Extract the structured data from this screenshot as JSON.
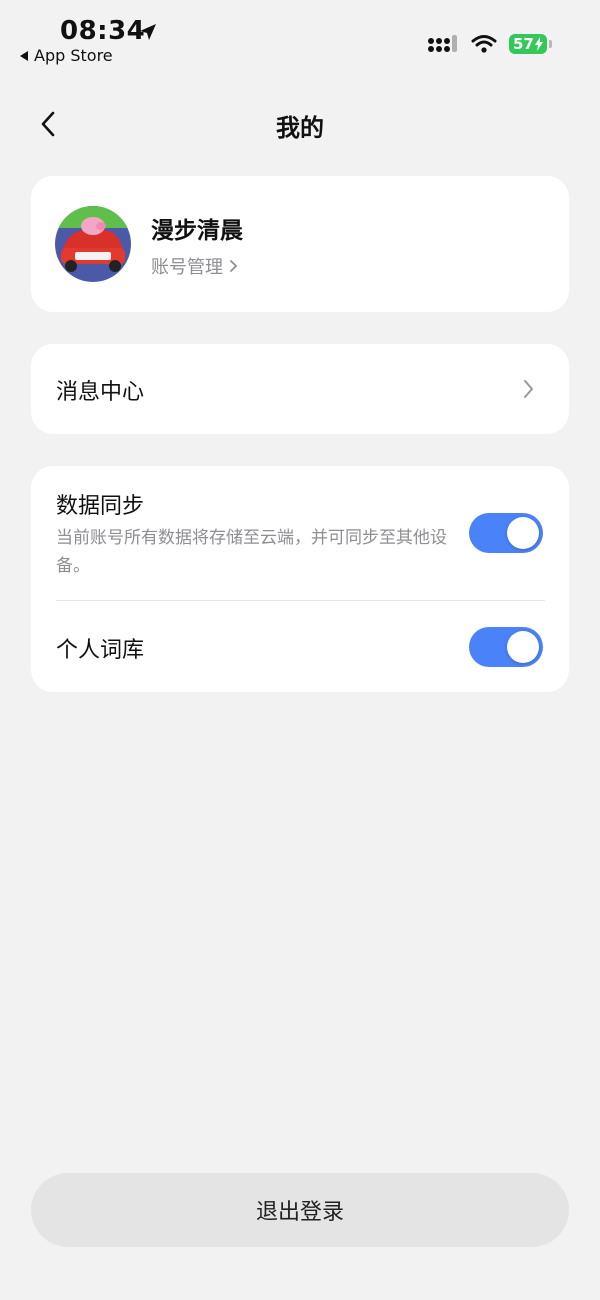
{
  "status_bar": {
    "time": "08:34",
    "back_app": "App Store",
    "battery": "57",
    "icons": [
      "location-arrow-icon",
      "signal-icon",
      "wifi-icon",
      "battery-charging-icon"
    ]
  },
  "nav": {
    "title": "我的",
    "back_icon": "chevron-left-icon"
  },
  "profile": {
    "username": "漫步清晨",
    "account_link": "账号管理"
  },
  "menu": {
    "message_center": "消息中心"
  },
  "settings": {
    "data_sync": {
      "label": "数据同步",
      "description": "当前账号所有数据将存储至云端，并可同步至其他设备。",
      "enabled": true
    },
    "personal_dictionary": {
      "label": "个人词库",
      "enabled": true
    }
  },
  "logout_label": "退出登录",
  "colors": {
    "background": "#f2f2f2",
    "toggle_on": "#4a82f7",
    "battery": "#34c759",
    "secondary_text": "#8e8e93"
  }
}
